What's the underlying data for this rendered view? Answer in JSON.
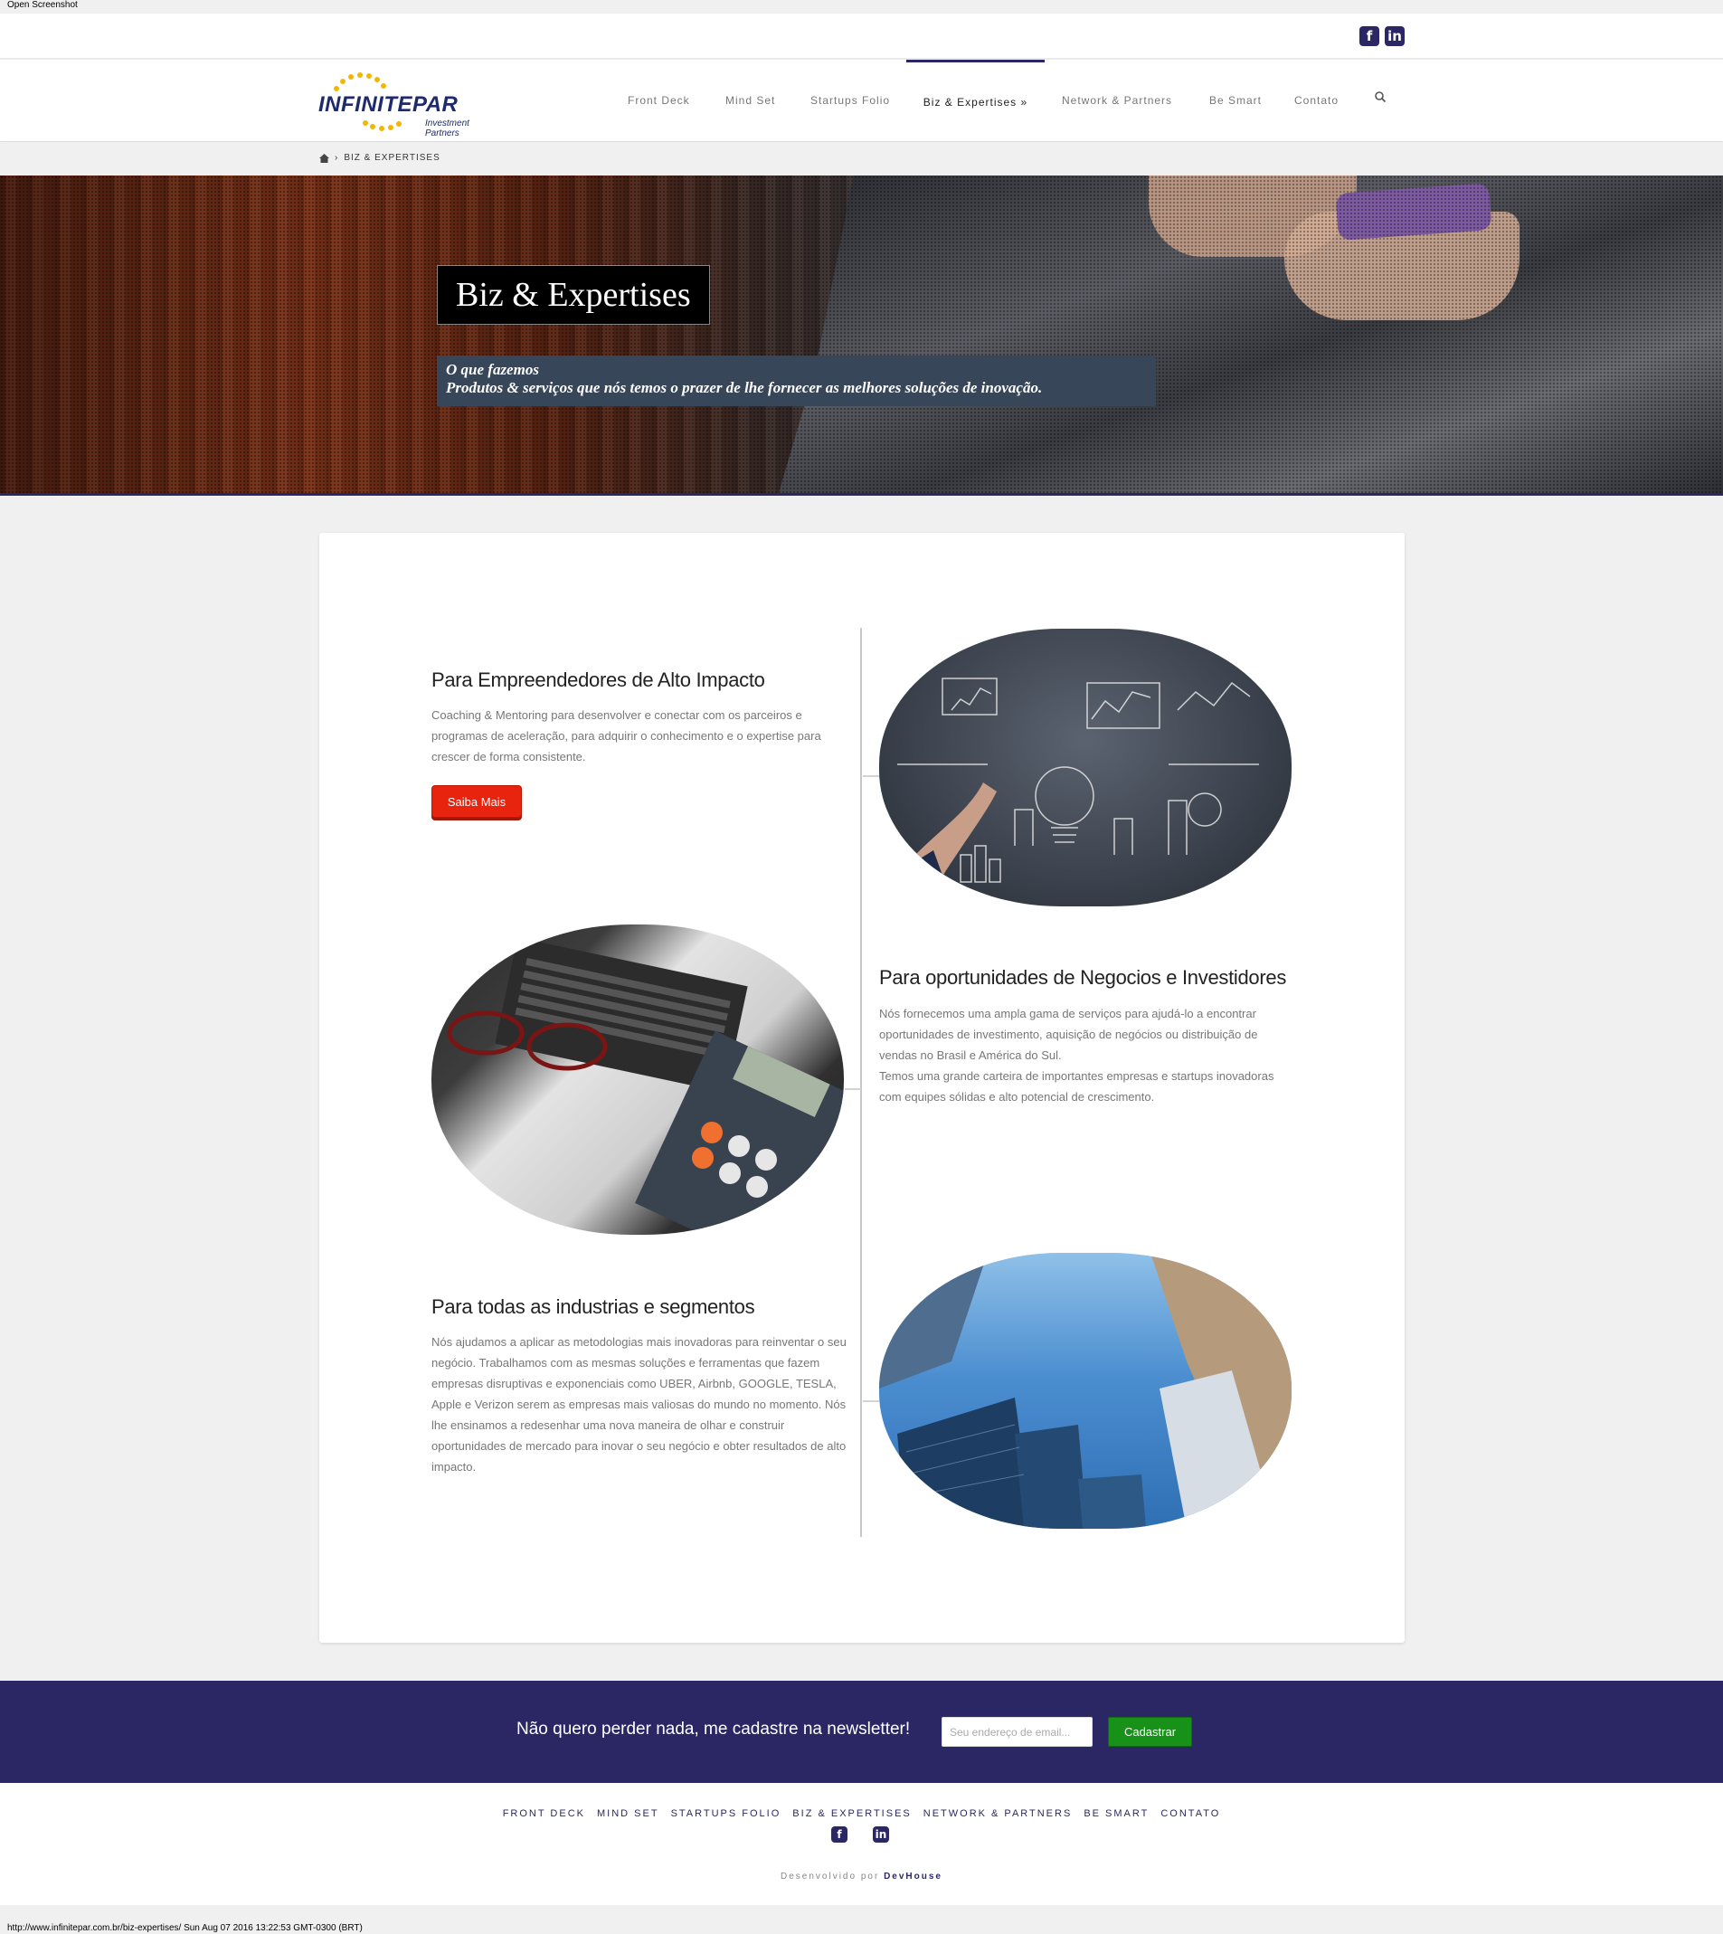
{
  "screenshot_label": "Open Screenshot",
  "social": {
    "facebook": "f",
    "linkedin": "in"
  },
  "logo": {
    "name": "INFINITEPAR",
    "tagline": "Investment Partners"
  },
  "nav": {
    "items": [
      "Front Deck",
      "Mind Set",
      "Startups Folio",
      "Biz & Expertises",
      "Network & Partners",
      "Be Smart",
      "Contato"
    ],
    "active": "Biz & Expertises",
    "active_suffix": "»"
  },
  "breadcrumb": {
    "current": "BIZ & EXPERTISES",
    "separator": "›"
  },
  "hero": {
    "title": "Biz & Expertises",
    "subtitle_line1": "O que fazemos",
    "subtitle_line2": "Produtos & serviços que nós temos o prazer de lhe fornecer as melhores soluções de inovação."
  },
  "blocks": [
    {
      "title": "Para Empreendedores de Alto Impacto",
      "text": "Coaching & Mentoring para desenvolver e conectar com os parceiros e programas de aceleração, para adquirir o conhecimento e o expertise para crescer de forma consistente.",
      "button": "Saiba Mais"
    },
    {
      "title": "Para oportunidades de Negocios e Investidores",
      "text1": "Nós fornecemos uma ampla gama de serviços para ajudá-lo a encontrar oportunidades de investimento, aquisição de negócios ou distribuição de vendas no Brasil e América do Sul.",
      "text2": "Temos uma grande carteira de importantes empresas e startups inovadoras com equipes sólidas e alto potencial de crescimento."
    },
    {
      "title": "Para todas as industrias e segmentos",
      "text": "Nós ajudamos a aplicar as metodologias mais inovadoras para reinventar o seu negócio. Trabalhamos com as mesmas soluções e ferramentas que fazem empresas disruptivas e exponenciais como UBER, Airbnb, GOOGLE, TESLA, Apple e Verizon serem as empresas mais valiosas do mundo no momento. Nós lhe ensinamos a redesenhar uma nova maneira de olhar e construir oportunidades de mercado para inovar o seu negócio e obter resultados de alto impacto."
    }
  ],
  "newsletter": {
    "text": "Não quero perder nada, me cadastre na newsletter!",
    "placeholder": "Seu endereço de email...",
    "button": "Cadastrar"
  },
  "footer": {
    "nav": [
      "FRONT DECK",
      "MIND SET",
      "STARTUPS FOLIO",
      "BIZ & EXPERTISES",
      "NETWORK & PARTNERS",
      "BE SMART",
      "CONTATO"
    ],
    "credit_prefix": "Desenvolvido por",
    "credit_name": "DevHouse"
  },
  "bottom_url": "http://www.infinitepar.com.br/biz-expertises/ Sun Aug 07 2016 13:22:53 GMT-0300 (BRT)",
  "colors": {
    "brand": "#2b2764",
    "button_red": "#e8240f",
    "button_green": "#179117"
  }
}
